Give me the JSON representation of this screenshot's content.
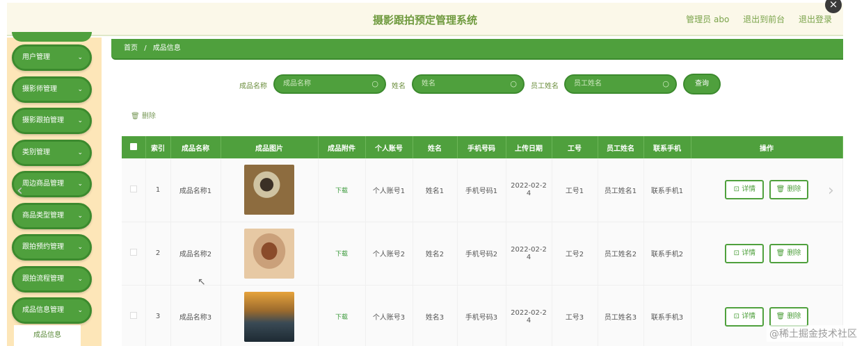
{
  "app": {
    "title": "摄影跟拍预定管理系统",
    "user_label": "管理员 abo",
    "front_link": "退出到前台",
    "logout": "退出登录"
  },
  "sidebar": {
    "items": [
      {
        "label": "用户管理"
      },
      {
        "label": "摄影师管理"
      },
      {
        "label": "摄影跟拍管理"
      },
      {
        "label": "类别管理"
      },
      {
        "label": "周边商品管理"
      },
      {
        "label": "商品类型管理"
      },
      {
        "label": "跟拍预约管理"
      },
      {
        "label": "跟拍流程管理"
      },
      {
        "label": "成品信息管理"
      }
    ],
    "sub_item": "成品信息"
  },
  "breadcrumb": {
    "home": "首页",
    "sep": "/",
    "current": "成品信息"
  },
  "search": {
    "name_label": "成品名称",
    "name_placeholder": "成品名称",
    "person_label": "姓名",
    "person_placeholder": "姓名",
    "staff_label": "员工姓名",
    "staff_placeholder": "员工姓名",
    "query_button": "查询"
  },
  "toolbar": {
    "batch_delete": "删除"
  },
  "table": {
    "headers": [
      "",
      "索引",
      "成品名称",
      "成品图片",
      "成品附件",
      "个人账号",
      "姓名",
      "手机号码",
      "上传日期",
      "工号",
      "员工姓名",
      "联系手机",
      "操作"
    ],
    "rows": [
      {
        "index": "1",
        "name": "成品名称1",
        "attachment": "下载",
        "account": "个人账号1",
        "person": "姓名1",
        "phone": "手机号码1",
        "date": "2022-02-2",
        "date2": "4",
        "staff_no": "工号1",
        "staff": "员工姓名1",
        "contact": "联系手机1"
      },
      {
        "index": "2",
        "name": "成品名称2",
        "attachment": "下载",
        "account": "个人账号2",
        "person": "姓名2",
        "phone": "手机号码2",
        "date": "2022-02-2",
        "date2": "4",
        "staff_no": "工号2",
        "staff": "员工姓名2",
        "contact": "联系手机2"
      },
      {
        "index": "3",
        "name": "成品名称3",
        "attachment": "下载",
        "account": "个人账号3",
        "person": "姓名3",
        "phone": "手机号码3",
        "date": "2022-02-2",
        "date2": "4",
        "staff_no": "工号3",
        "staff": "员工姓名3",
        "contact": "联系手机3"
      }
    ],
    "detail_label": "详情",
    "delete_label": "删除"
  },
  "watermark": "@稀土掘金技术社区",
  "colors": {
    "primary": "#4fa03d",
    "sidebar_bg": "#fde6b8",
    "topbar_bg": "#fbf8e9"
  }
}
